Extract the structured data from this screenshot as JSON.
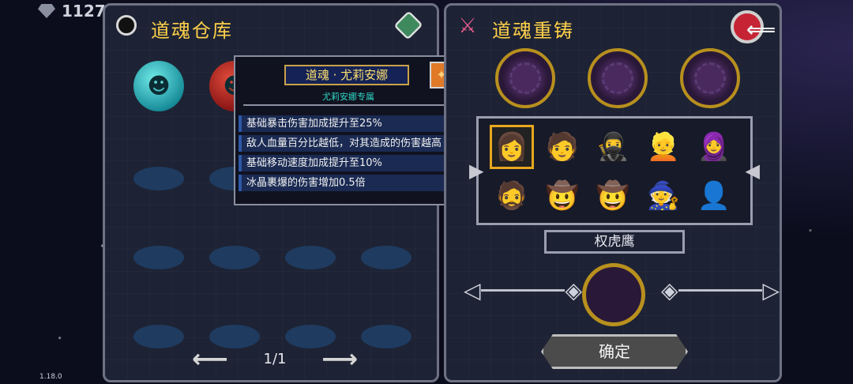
{
  "currency": {
    "icon": "diamond-icon",
    "amount": "1127"
  },
  "left_panel": {
    "title": "道魂仓库",
    "souls": [
      {
        "kind": "orb",
        "color": "#1a8f9c",
        "icon": "mask-icon"
      },
      {
        "kind": "orb",
        "color": "#8a1616",
        "icon": "mask-icon"
      },
      {
        "kind": "empty"
      },
      {
        "kind": "empty"
      },
      {
        "kind": "empty"
      },
      {
        "kind": "empty"
      },
      {
        "kind": "empty"
      },
      {
        "kind": "empty"
      },
      {
        "kind": "empty"
      },
      {
        "kind": "empty"
      },
      {
        "kind": "empty"
      },
      {
        "kind": "empty"
      },
      {
        "kind": "empty"
      },
      {
        "kind": "empty"
      },
      {
        "kind": "empty"
      },
      {
        "kind": "empty"
      }
    ],
    "pager": {
      "text": "1/1"
    }
  },
  "tooltip": {
    "title": "道魂 · 尤莉安娜",
    "subtitle": "尤莉安娜专属",
    "effects": [
      "基础暴击伤害加成提升至25%",
      "敌人血量百分比越低，对其造成的伤害越高",
      "基础移动速度加成提升至10%",
      "冰晶裹爆的伤害增加0.5倍"
    ]
  },
  "right_panel": {
    "title": "道魂重铸",
    "characters": [
      "👩",
      "🧑",
      "🥷",
      "👱",
      "🧕",
      "🧔",
      "🤠",
      "🤠",
      "🧙",
      "👤"
    ],
    "selected_index": 0,
    "selected_name": "权虎鹰",
    "confirm_label": "确定"
  },
  "version": "1.18.0"
}
